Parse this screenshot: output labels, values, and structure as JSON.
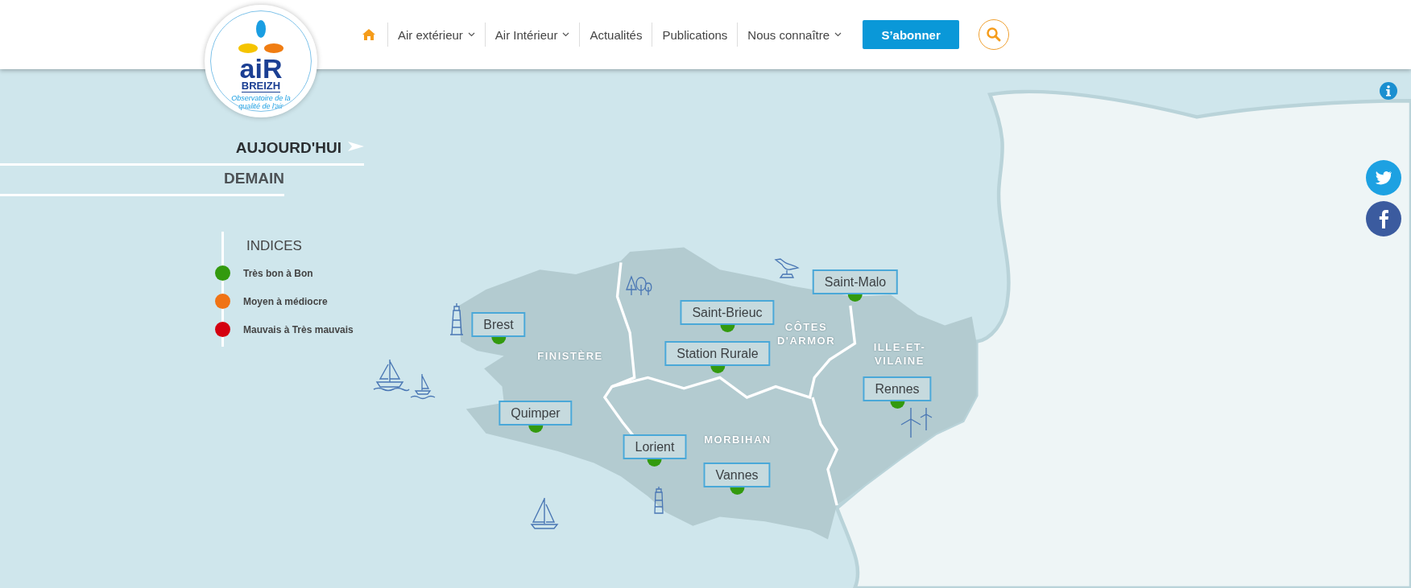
{
  "logo": {
    "wordmark": "aiR",
    "name": "BREIZH",
    "tagline": "Observatoire de la qualité de l'air"
  },
  "nav": [
    {
      "kind": "home"
    },
    {
      "kind": "dropdown",
      "label": "Air extérieur"
    },
    {
      "kind": "dropdown",
      "label": "Air Intérieur"
    },
    {
      "kind": "link",
      "label": "Actualités"
    },
    {
      "kind": "link",
      "label": "Publications"
    },
    {
      "kind": "dropdown",
      "label": "Nous connaître"
    }
  ],
  "subscribe_button": "S’abonner",
  "day_tabs": [
    {
      "label": "AUJOURD'HUI",
      "selected": true
    },
    {
      "label": "DEMAIN",
      "selected": false
    }
  ],
  "legend": {
    "title": "INDICES",
    "items": [
      {
        "label": "Très bon à Bon",
        "color": "#339a0e"
      },
      {
        "label": "Moyen à médiocre",
        "color": "#f07315"
      },
      {
        "label": "Mauvais à Très mauvais",
        "color": "#d40010"
      }
    ]
  },
  "regions": [
    "FINISTÈRE",
    "CÔTES D'ARMOR",
    "MORBIHAN",
    "ILLE-ET-VILAINE"
  ],
  "stations": [
    {
      "name": "Brest",
      "color": "#339a0e"
    },
    {
      "name": "Saint-Brieuc",
      "color": "#339a0e"
    },
    {
      "name": "Station Rurale",
      "color": "#339a0e"
    },
    {
      "name": "Saint-Malo",
      "color": "#339a0e"
    },
    {
      "name": "Rennes",
      "color": "#339a0e"
    },
    {
      "name": "Quimper",
      "color": "#339a0e"
    },
    {
      "name": "Lorient",
      "color": "#339a0e"
    },
    {
      "name": "Vannes",
      "color": "#339a0e"
    }
  ]
}
